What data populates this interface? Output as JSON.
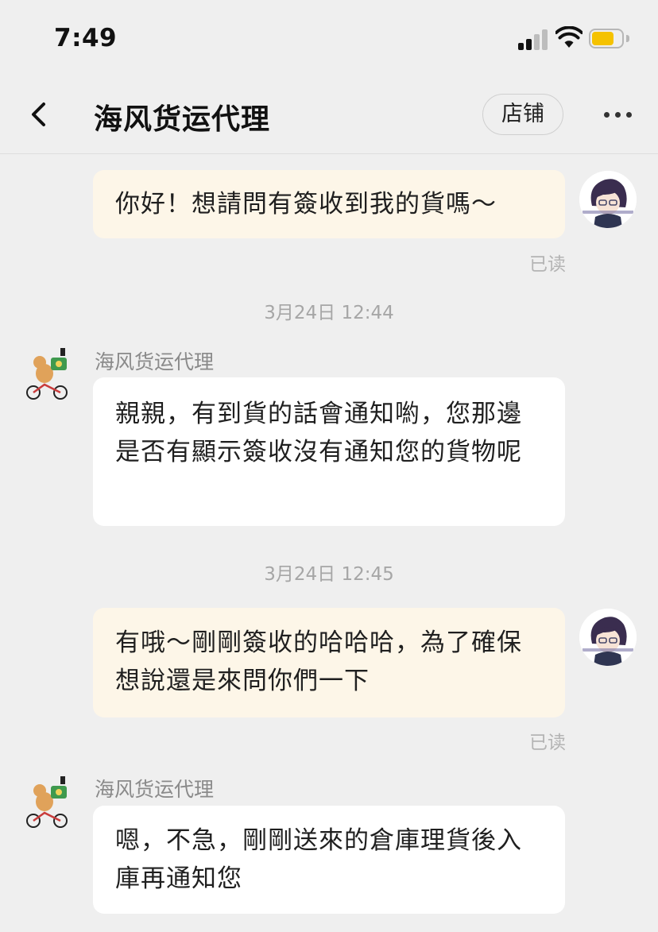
{
  "status_bar": {
    "time": "7:49",
    "battery_color": "#f5c200"
  },
  "header": {
    "back_icon": "chevron-left-icon",
    "title": "海风货运代理",
    "store_button": "店铺",
    "more_icon": "more-horizontal-icon"
  },
  "messages": [
    {
      "from": "me",
      "text": "你好！想請問有簽收到我的貨嗎～",
      "read": "已读"
    },
    {
      "type": "timestamp",
      "text": "3月24日 12:44"
    },
    {
      "from": "shop",
      "sender": "海风货运代理",
      "text": "親親，有到貨的話會通知喲，您那邊是否有顯示簽收沒有通知您的貨物呢"
    },
    {
      "type": "timestamp",
      "text": "3月24日 12:45"
    },
    {
      "from": "me",
      "text": "有哦～剛剛簽收的哈哈哈，為了確保想說還是來問你們一下",
      "read": "已读"
    },
    {
      "from": "shop",
      "sender": "海风货运代理",
      "text": "嗯，不急，剛剛送來的倉庫理貨後入庫再通知您"
    }
  ],
  "colors": {
    "background": "#efefef",
    "my_bubble": "#fdf6e8",
    "their_bubble": "#ffffff"
  }
}
